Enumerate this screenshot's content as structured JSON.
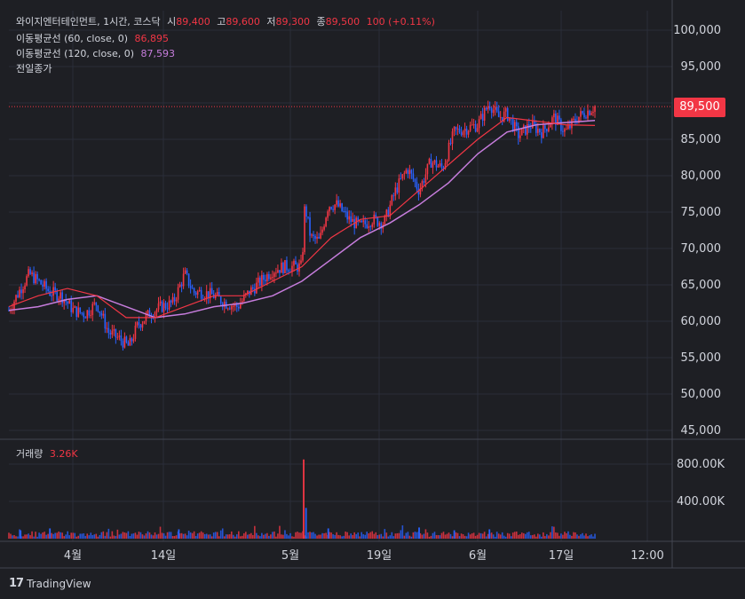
{
  "legend": {
    "symbol": "와이지엔터테인먼트, 1시간, 코스닥",
    "o_label": "시",
    "o_val": "89,400",
    "h_label": "고",
    "h_val": "89,600",
    "l_label": "저",
    "l_val": "89,300",
    "c_label": "종",
    "c_val": "89,500",
    "chg": "100 (+0.11%)",
    "ma60_label": "이동평균선 (60, close, 0)",
    "ma60_val": "86,895",
    "ma120_label": "이동평균선 (120, close, 0)",
    "ma120_val": "87,593",
    "prev_close_label": "전일종가",
    "volume_label": "거래량",
    "volume_val": "3.26K"
  },
  "price_tag": "89,500",
  "footer": {
    "brand": "TradingView"
  },
  "colors": {
    "up": "#f23645",
    "down": "#2962ff",
    "ma60": "#f23645",
    "ma120": "#c77ddd",
    "bg": "#1e1f24",
    "grid": "#2a2e39"
  },
  "chart_data": {
    "type": "candlestick",
    "price_axis": {
      "ylim": [
        45000,
        100000
      ],
      "ticks": [
        "45,000",
        "50,000",
        "55,000",
        "60,000",
        "65,000",
        "70,000",
        "75,000",
        "80,000",
        "85,000",
        "90,000",
        "95,000",
        "100,000"
      ]
    },
    "volume_axis": {
      "ticks": [
        "400.00K",
        "800.00K"
      ]
    },
    "time_ticks": [
      "4월",
      "14일",
      "5월",
      "19일",
      "6월",
      "17일",
      "12:00"
    ],
    "last_price": 89500,
    "prev_close": 89500,
    "price_path": [
      {
        "t": 0,
        "v": 61500
      },
      {
        "t": 0.02,
        "v": 64500
      },
      {
        "t": 0.035,
        "v": 66500
      },
      {
        "t": 0.05,
        "v": 65500
      },
      {
        "t": 0.07,
        "v": 64000
      },
      {
        "t": 0.09,
        "v": 63500
      },
      {
        "t": 0.11,
        "v": 61500
      },
      {
        "t": 0.13,
        "v": 61000
      },
      {
        "t": 0.15,
        "v": 62500
      },
      {
        "t": 0.17,
        "v": 58500
      },
      {
        "t": 0.19,
        "v": 57500
      },
      {
        "t": 0.205,
        "v": 56500
      },
      {
        "t": 0.22,
        "v": 59500
      },
      {
        "t": 0.24,
        "v": 61000
      },
      {
        "t": 0.26,
        "v": 62000
      },
      {
        "t": 0.28,
        "v": 62500
      },
      {
        "t": 0.3,
        "v": 66500
      },
      {
        "t": 0.315,
        "v": 64000
      },
      {
        "t": 0.33,
        "v": 64000
      },
      {
        "t": 0.35,
        "v": 63500
      },
      {
        "t": 0.37,
        "v": 62500
      },
      {
        "t": 0.39,
        "v": 62000
      },
      {
        "t": 0.41,
        "v": 64000
      },
      {
        "t": 0.43,
        "v": 65500
      },
      {
        "t": 0.45,
        "v": 67000
      },
      {
        "t": 0.47,
        "v": 67500
      },
      {
        "t": 0.49,
        "v": 67500
      },
      {
        "t": 0.5,
        "v": 67500
      },
      {
        "t": 0.505,
        "v": 76000
      },
      {
        "t": 0.515,
        "v": 71500
      },
      {
        "t": 0.53,
        "v": 71000
      },
      {
        "t": 0.545,
        "v": 76000
      },
      {
        "t": 0.56,
        "v": 76000
      },
      {
        "t": 0.58,
        "v": 74000
      },
      {
        "t": 0.6,
        "v": 73000
      },
      {
        "t": 0.62,
        "v": 74000
      },
      {
        "t": 0.64,
        "v": 73500
      },
      {
        "t": 0.66,
        "v": 78000
      },
      {
        "t": 0.68,
        "v": 81000
      },
      {
        "t": 0.7,
        "v": 78000
      },
      {
        "t": 0.72,
        "v": 82000
      },
      {
        "t": 0.74,
        "v": 81000
      },
      {
        "t": 0.76,
        "v": 86000
      },
      {
        "t": 0.78,
        "v": 86500
      },
      {
        "t": 0.8,
        "v": 87000
      },
      {
        "t": 0.82,
        "v": 90000
      },
      {
        "t": 0.835,
        "v": 88000
      },
      {
        "t": 0.85,
        "v": 88500
      },
      {
        "t": 0.87,
        "v": 85500
      },
      {
        "t": 0.89,
        "v": 87000
      },
      {
        "t": 0.91,
        "v": 86000
      },
      {
        "t": 0.93,
        "v": 88000
      },
      {
        "t": 0.95,
        "v": 86000
      },
      {
        "t": 0.97,
        "v": 88000
      },
      {
        "t": 1.0,
        "v": 89500
      }
    ],
    "ma60_path": [
      {
        "t": 0,
        "v": 62000
      },
      {
        "t": 0.05,
        "v": 63500
      },
      {
        "t": 0.1,
        "v": 64500
      },
      {
        "t": 0.15,
        "v": 63500
      },
      {
        "t": 0.2,
        "v": 60500
      },
      {
        "t": 0.25,
        "v": 60500
      },
      {
        "t": 0.3,
        "v": 62000
      },
      {
        "t": 0.35,
        "v": 63500
      },
      {
        "t": 0.4,
        "v": 63500
      },
      {
        "t": 0.45,
        "v": 65500
      },
      {
        "t": 0.5,
        "v": 67500
      },
      {
        "t": 0.55,
        "v": 71500
      },
      {
        "t": 0.6,
        "v": 74000
      },
      {
        "t": 0.65,
        "v": 74500
      },
      {
        "t": 0.7,
        "v": 78000
      },
      {
        "t": 0.75,
        "v": 81500
      },
      {
        "t": 0.8,
        "v": 85000
      },
      {
        "t": 0.85,
        "v": 88000
      },
      {
        "t": 0.9,
        "v": 87500
      },
      {
        "t": 0.95,
        "v": 87000
      },
      {
        "t": 1.0,
        "v": 86900
      }
    ],
    "ma120_path": [
      {
        "t": 0,
        "v": 61500
      },
      {
        "t": 0.05,
        "v": 62000
      },
      {
        "t": 0.1,
        "v": 63000
      },
      {
        "t": 0.15,
        "v": 63500
      },
      {
        "t": 0.2,
        "v": 62000
      },
      {
        "t": 0.25,
        "v": 60500
      },
      {
        "t": 0.3,
        "v": 61000
      },
      {
        "t": 0.35,
        "v": 62000
      },
      {
        "t": 0.4,
        "v": 62500
      },
      {
        "t": 0.45,
        "v": 63500
      },
      {
        "t": 0.5,
        "v": 65500
      },
      {
        "t": 0.55,
        "v": 68500
      },
      {
        "t": 0.6,
        "v": 71500
      },
      {
        "t": 0.65,
        "v": 73500
      },
      {
        "t": 0.7,
        "v": 76000
      },
      {
        "t": 0.75,
        "v": 79000
      },
      {
        "t": 0.8,
        "v": 83000
      },
      {
        "t": 0.85,
        "v": 86000
      },
      {
        "t": 0.9,
        "v": 87000
      },
      {
        "t": 0.95,
        "v": 87300
      },
      {
        "t": 1.0,
        "v": 87600
      }
    ],
    "volume_spikes": [
      {
        "t": 0.503,
        "v": 850000
      },
      {
        "t": 0.507,
        "v": 330000
      },
      {
        "t": 0.02,
        "v": 90000
      },
      {
        "t": 0.07,
        "v": 110000
      },
      {
        "t": 0.29,
        "v": 100000
      },
      {
        "t": 0.545,
        "v": 110000
      },
      {
        "t": 0.7,
        "v": 120000
      },
      {
        "t": 0.76,
        "v": 90000
      },
      {
        "t": 0.82,
        "v": 100000
      }
    ]
  }
}
